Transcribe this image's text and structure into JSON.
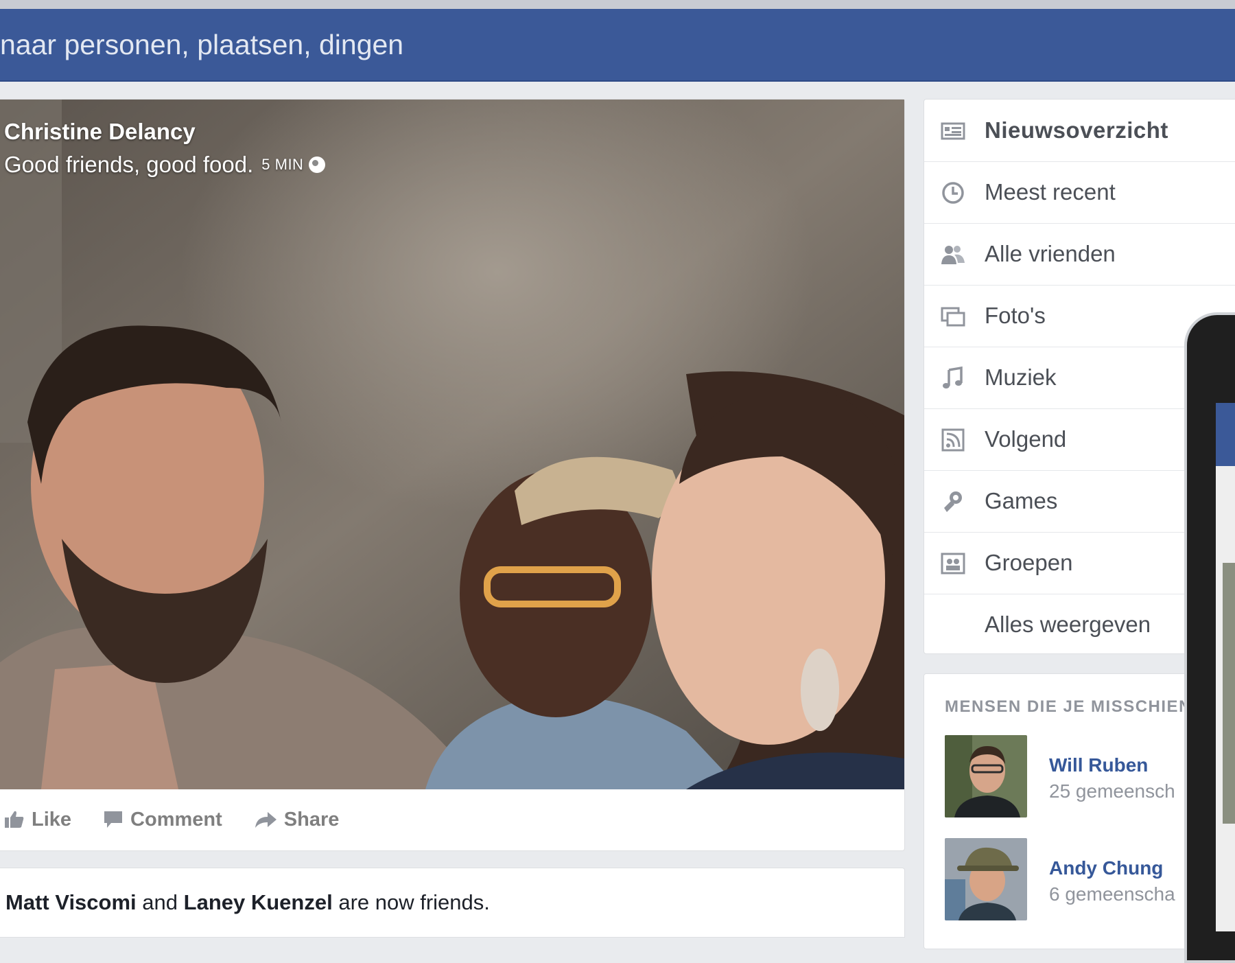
{
  "topbar": {
    "search_placeholder": "naar personen, plaatsen, dingen",
    "bg_color": "#3b5998"
  },
  "post": {
    "author": "Christine Delancy",
    "text": "Good friends, good food.",
    "time": "5 MIN",
    "privacy_icon": "globe-icon",
    "actions": [
      {
        "label": "Like",
        "icon": "thumbs-up-icon"
      },
      {
        "label": "Comment",
        "icon": "comment-icon"
      },
      {
        "label": "Share",
        "icon": "share-icon"
      }
    ]
  },
  "friends_story": {
    "person1": "Matt Viscomi",
    "connector": "and",
    "person2": "Laney Kuenzel",
    "suffix": "are now friends."
  },
  "sidebar": {
    "items": [
      {
        "label": "Nieuwsoverzicht",
        "icon": "news-feed-icon",
        "active": true
      },
      {
        "label": "Meest recent",
        "icon": "clock-icon"
      },
      {
        "label": "Alle vrienden",
        "icon": "friends-icon"
      },
      {
        "label": "Foto's",
        "icon": "photos-icon"
      },
      {
        "label": "Muziek",
        "icon": "music-icon"
      },
      {
        "label": "Volgend",
        "icon": "following-icon"
      },
      {
        "label": "Games",
        "icon": "games-icon"
      },
      {
        "label": "Groepen",
        "icon": "groups-icon"
      },
      {
        "label": "Alles weergeven",
        "icon": ""
      }
    ]
  },
  "pymk": {
    "title": "MENSEN DIE JE MISSCHIEN K",
    "people": [
      {
        "name": "Will Ruben",
        "mutual": "25 gemeensch"
      },
      {
        "name": "Andy Chung",
        "mutual": "6 gemeenscha"
      }
    ]
  }
}
